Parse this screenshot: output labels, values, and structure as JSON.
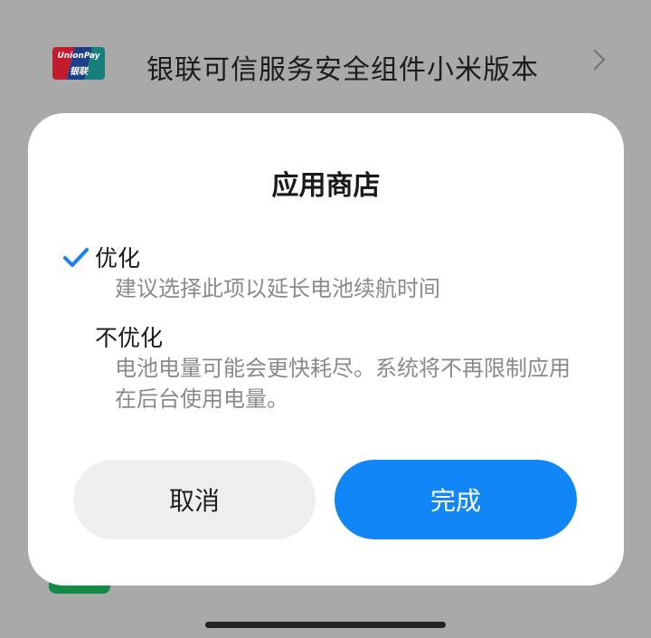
{
  "background_item": {
    "title": "银联可信服务安全组件小米版本",
    "logo_line1": "UnionPay",
    "logo_line2": "银联",
    "icon": "chevron-right-icon"
  },
  "dialog": {
    "title": "应用商店",
    "selected_option": "优化",
    "options": [
      {
        "label": "优化",
        "description": "建议选择此项以延长电池续航时间",
        "selected": true
      },
      {
        "label": "不优化",
        "description": "电池电量可能会更快耗尽。系统将不再限制应用在后台使用电量。",
        "selected": false
      }
    ],
    "cancel_label": "取消",
    "done_label": "完成"
  },
  "colors": {
    "accent": "#1086f7",
    "check": "#1a7ff0",
    "overlay": "#a9a9a9"
  }
}
